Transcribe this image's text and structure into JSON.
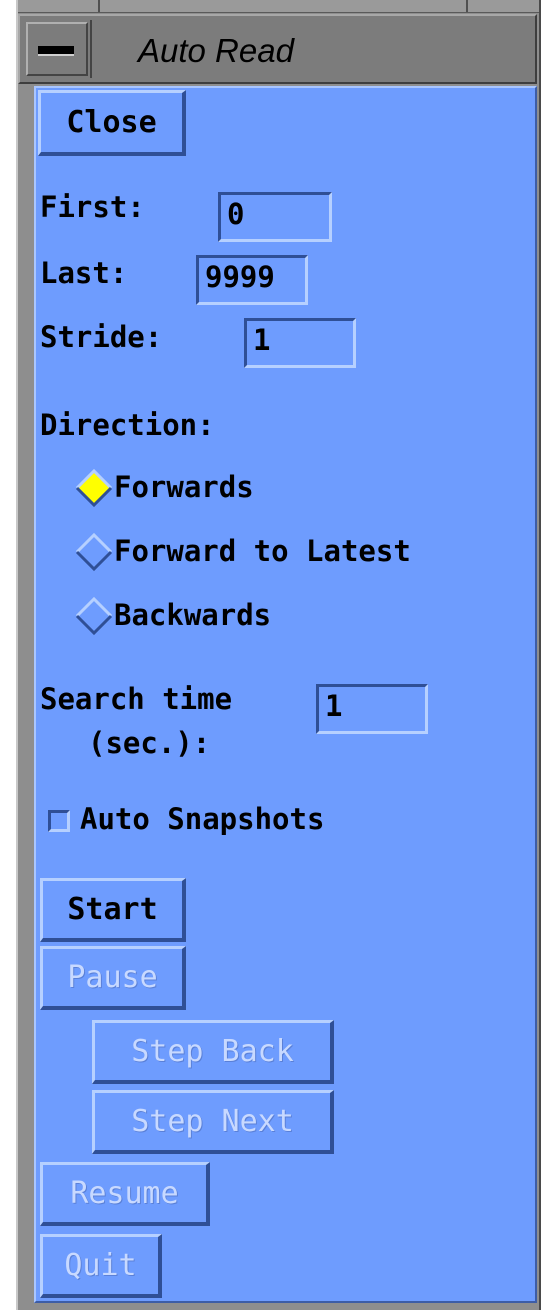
{
  "window": {
    "title": "Auto Read"
  },
  "buttons": {
    "close": "Close",
    "start": "Start",
    "pause": "Pause",
    "step_back": "Step Back",
    "step_next": "Step Next",
    "resume": "Resume",
    "quit": "Quit"
  },
  "fields": {
    "first": {
      "label": "First:",
      "value": "0"
    },
    "last": {
      "label": "Last:",
      "value": "9999"
    },
    "stride": {
      "label": "Stride:",
      "value": "1"
    },
    "search_time": {
      "label_line1": "Search time",
      "label_line2": "(sec.):",
      "value": "1"
    }
  },
  "direction": {
    "label": "Direction:",
    "options": [
      {
        "label": "Forwards",
        "selected": true
      },
      {
        "label": "Forward to Latest",
        "selected": false
      },
      {
        "label": "Backwards",
        "selected": false
      }
    ]
  },
  "auto_snapshots": {
    "label": "Auto Snapshots",
    "checked": false
  },
  "colors": {
    "panel": "#6e9cfe",
    "radio_selected": "#ffff00",
    "titlebar": "#7c7c7c"
  }
}
